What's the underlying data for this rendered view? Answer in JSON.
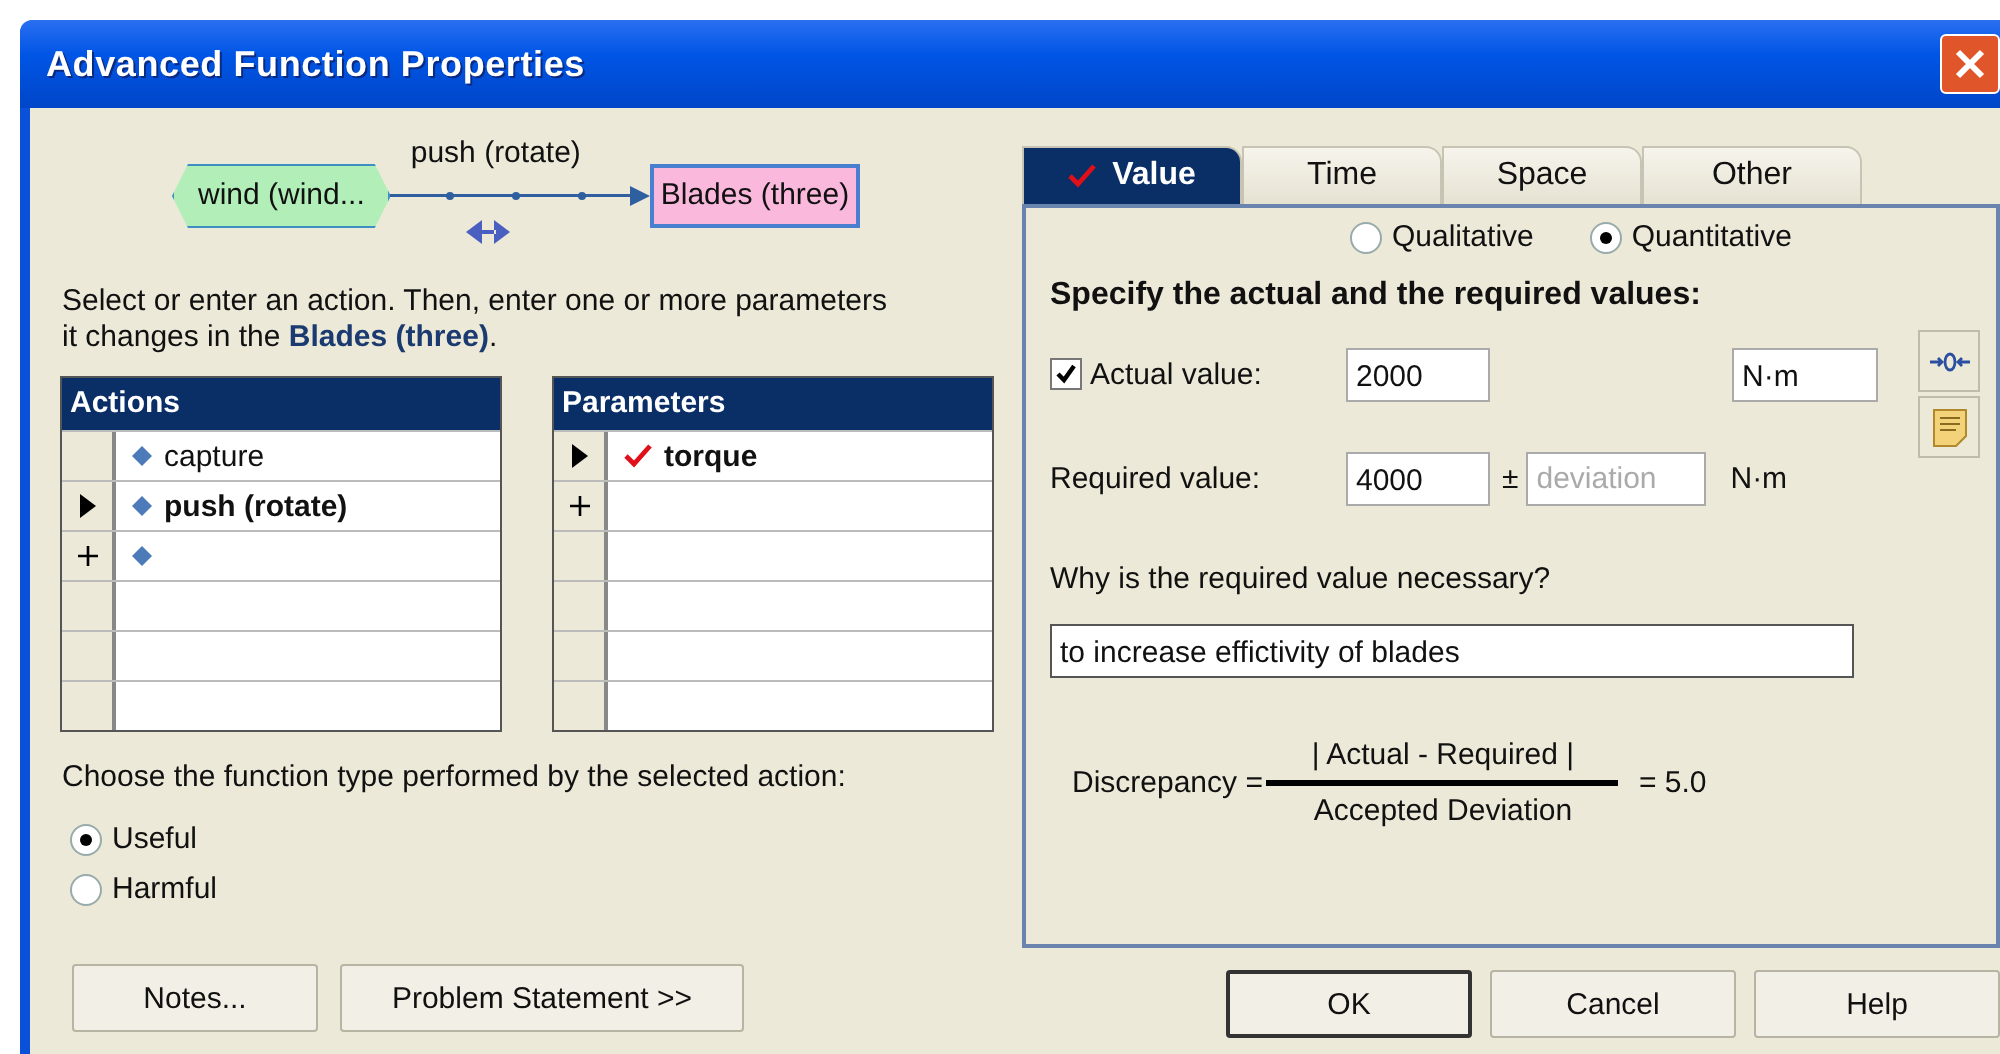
{
  "window": {
    "title": "Advanced Function Properties"
  },
  "diagram": {
    "source": "wind (wind...",
    "action": "push (rotate)",
    "target": "Blades (three)"
  },
  "instruction": "Select or enter an action. Then, enter one or more parameters\nit changes in the **Blades (three)**.",
  "actions": {
    "header": "Actions",
    "rows": [
      {
        "kind": "item",
        "label": "capture",
        "selected": false
      },
      {
        "kind": "item",
        "label": "push (rotate)",
        "selected": true
      },
      {
        "kind": "new"
      }
    ]
  },
  "parameters": {
    "header": "Parameters",
    "rows": [
      {
        "kind": "item",
        "label": "torque",
        "checked": true,
        "selected": true
      },
      {
        "kind": "new"
      }
    ]
  },
  "function_type": {
    "prompt": "Choose the function type performed by the selected action:",
    "options": [
      {
        "label": "Useful",
        "selected": true
      },
      {
        "label": "Harmful",
        "selected": false
      }
    ]
  },
  "left_buttons": [
    "Notes...",
    "Problem Statement >>"
  ],
  "tabs": [
    {
      "label": "Value",
      "selected": true,
      "checked": true
    },
    {
      "label": "Time",
      "selected": false,
      "checked": false
    },
    {
      "label": "Space",
      "selected": false,
      "checked": false
    },
    {
      "label": "Other",
      "selected": false,
      "checked": false
    }
  ],
  "modes": [
    {
      "label": "Qualitative",
      "selected": false
    },
    {
      "label": "Quantitative",
      "selected": true
    }
  ],
  "heading": "Specify the actual and the required values:",
  "actual": {
    "checked": true,
    "label": "Actual value:",
    "value": "2000",
    "unit": "N·m"
  },
  "required": {
    "label": "Required value:",
    "value": "4000",
    "plus_minus": "±",
    "deviation_placeholder": "deviation",
    "unit": "N·m"
  },
  "question": {
    "label": "Why is the required value necessary?",
    "value": "to increase effictivity of blades"
  },
  "discrepancy": {
    "label": "Discrepancy =",
    "numerator": "| Actual - Required |",
    "denominator": "Accepted Deviation",
    "result": "= 5.0"
  },
  "dialog_buttons": [
    {
      "label": "OK",
      "default": true
    },
    {
      "label": "Cancel",
      "default": false
    },
    {
      "label": "Help",
      "default": false
    }
  ]
}
